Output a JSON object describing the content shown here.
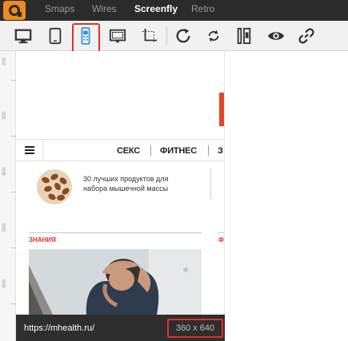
{
  "topnav": {
    "items": [
      {
        "label": "Smaps",
        "active": false
      },
      {
        "label": "Wires",
        "active": false
      },
      {
        "label": "Screenfly",
        "active": true
      },
      {
        "label": "Retro",
        "active": false
      }
    ]
  },
  "toolbar": {
    "tools": [
      {
        "icon": "desktop-icon",
        "selected": false
      },
      {
        "icon": "tablet-icon",
        "selected": false
      },
      {
        "icon": "mobile-icon",
        "selected": true
      },
      {
        "icon": "tv-icon",
        "selected": false
      },
      {
        "icon": "custom-size-icon",
        "selected": false
      },
      {
        "icon": "rotate-icon",
        "selected": false
      },
      {
        "icon": "refresh-icon",
        "selected": false
      },
      {
        "icon": "scrollbar-icon",
        "selected": false
      },
      {
        "icon": "eye-icon",
        "selected": false
      },
      {
        "icon": "link-icon",
        "selected": false
      }
    ],
    "highlight_color": "#e0302a"
  },
  "ruler": {
    "labels": [
      "200",
      "300",
      "400",
      "500",
      "600"
    ]
  },
  "site": {
    "nav": {
      "items": [
        "СЕКС",
        "ФИТНЕС",
        "З"
      ]
    },
    "promo": {
      "text": "30 лучших продуктов для набора мышечной массы"
    },
    "section": {
      "label": "ЗНАНИЯ",
      "label2": "Ф"
    },
    "accent": "#e0302a"
  },
  "status": {
    "url": "https://mhealth.ru/",
    "size": "360 x 640"
  }
}
